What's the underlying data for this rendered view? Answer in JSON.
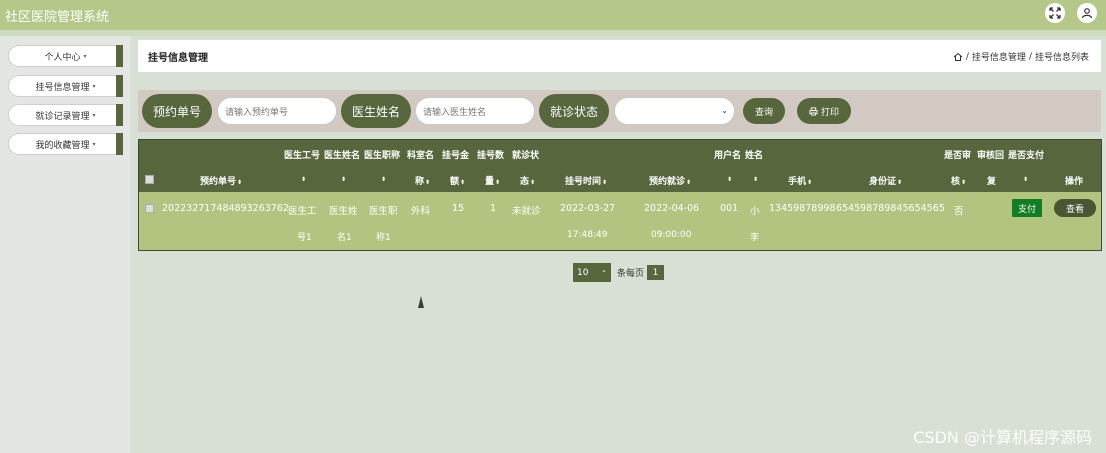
{
  "app": {
    "title": "社区医院管理系统"
  },
  "topbar_icons": [
    "fullscreen-icon",
    "user-icon"
  ],
  "sidebar": {
    "items": [
      {
        "label": "个人中心",
        "caret": "▾"
      },
      {
        "label": "挂号信息管理",
        "caret": "▾"
      },
      {
        "label": "就诊记录管理",
        "caret": "▾"
      },
      {
        "label": "我的收藏管理",
        "caret": "▾"
      }
    ]
  },
  "header": {
    "title": "挂号信息管理",
    "breadcrumb": {
      "sep": "/",
      "items": [
        "挂号信息管理",
        "挂号信息列表"
      ]
    }
  },
  "search": {
    "fields": [
      {
        "label": "预约单号",
        "placeholder": "请输入预约单号"
      },
      {
        "label": "医生姓名",
        "placeholder": "请输入医生姓名"
      },
      {
        "label": "就诊状态",
        "value": ""
      }
    ],
    "query_button": "查询",
    "print_button": "打印"
  },
  "table": {
    "headers": {
      "appointment_no": "预约单号",
      "doctor_id": [
        "医生工号",
        ""
      ],
      "doctor_name": [
        "医生姓名",
        ""
      ],
      "doctor_title": [
        "医生职称",
        ""
      ],
      "department": [
        "科室名",
        "称"
      ],
      "fee": [
        "挂号金",
        "额"
      ],
      "count": [
        "挂号数",
        "量"
      ],
      "status": [
        "就诊状",
        "态"
      ],
      "reg_time": "挂号时间",
      "visit_time": "预约就诊",
      "username": [
        "用户名",
        ""
      ],
      "name": [
        "姓名",
        ""
      ],
      "phone": "手机",
      "id_card": "身份证",
      "audit": [
        "是否审",
        "核"
      ],
      "reply": [
        "审核回",
        "复"
      ],
      "paid": [
        "是否支付",
        ""
      ],
      "actions": "操作"
    },
    "sort_glyph": "⬍",
    "rows": [
      {
        "appointment_no": "202232717484893263762",
        "doctor_id": [
          "医生工",
          "号1"
        ],
        "doctor_name": [
          "医生姓",
          "名1"
        ],
        "doctor_title": [
          "医生职",
          "称1"
        ],
        "department": "外科",
        "fee": "15",
        "count": "1",
        "status": "未就诊",
        "reg_time": [
          "2022-03-27",
          "17:48:49"
        ],
        "visit_time": [
          "2022-04-06",
          "09:00:00"
        ],
        "username": "001",
        "name": [
          "小",
          "李"
        ],
        "phone": "13459878998",
        "id_card": "654598789845654565",
        "audit": "否",
        "pay_button": "支付",
        "view_button": "查看"
      }
    ]
  },
  "pagination": {
    "page_size": "10",
    "per_page_label": "条每页",
    "current_page": "1"
  },
  "watermark": "CSDN @计算机程序源码",
  "colors": {
    "primary": "#58663d",
    "topbar": "#b6c889",
    "row": "#b2c47f",
    "pay": "#137d24",
    "search_bg": "#d2c9c2"
  }
}
